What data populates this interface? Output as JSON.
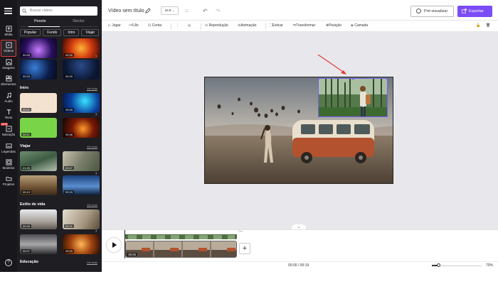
{
  "rail": {
    "items": [
      {
        "label": "Mídia",
        "icon": "upload-icon"
      },
      {
        "label": "Vídeos",
        "icon": "video-icon"
      },
      {
        "label": "Imagens",
        "icon": "image-icon"
      },
      {
        "label": "Elementos",
        "icon": "shapes-icon"
      },
      {
        "label": "Áudio",
        "icon": "music-icon"
      },
      {
        "label": "Texto",
        "icon": "text-icon"
      },
      {
        "label": "Narração",
        "icon": "voice-icon",
        "badge": "NEW"
      },
      {
        "label": "Legendas",
        "icon": "captions-icon"
      },
      {
        "label": "Modelos",
        "icon": "template-icon"
      },
      {
        "label": "Projetos",
        "icon": "folder-icon"
      }
    ]
  },
  "library": {
    "search_placeholder": "Buscar vídeos",
    "source_tabs": [
      "Pexels",
      "Stocks"
    ],
    "chips": [
      "Popular",
      "Fundo",
      "Intro",
      "Viajar"
    ],
    "see_all": "Ver tudo",
    "sections": [
      {
        "title": "Intro"
      },
      {
        "title": "Viajar"
      },
      {
        "title": "Estilo de vida"
      },
      {
        "title": "Educação"
      }
    ],
    "durations": {
      "popular": [
        "00:20",
        "00:30",
        "00:19",
        "00:20"
      ],
      "intro": [
        "00:01",
        "00:09",
        "00:11",
        "00:06"
      ],
      "viajar": [
        "01:26",
        "00:07",
        "00:19",
        "00:15"
      ],
      "estilo": [
        "00:26",
        "00:21",
        "00:07",
        "00:09"
      ]
    }
  },
  "header": {
    "title": "Vídeo sem título",
    "ratio": "16:9",
    "preview_label": "Pré-visualizar",
    "export_label": "Exportar",
    "accent": "#7b4cf5"
  },
  "toolbar": {
    "items": [
      "Jogar",
      "6.8s",
      "Cortar",
      "Reprodução",
      "Animação",
      "Esticar",
      "Transformar",
      "Posição",
      "Camada"
    ]
  },
  "timeline": {
    "clip_duration": "19.0s",
    "track_caption": "Fim",
    "current_time": "00:00 / 00:19",
    "zoom": "70%"
  }
}
